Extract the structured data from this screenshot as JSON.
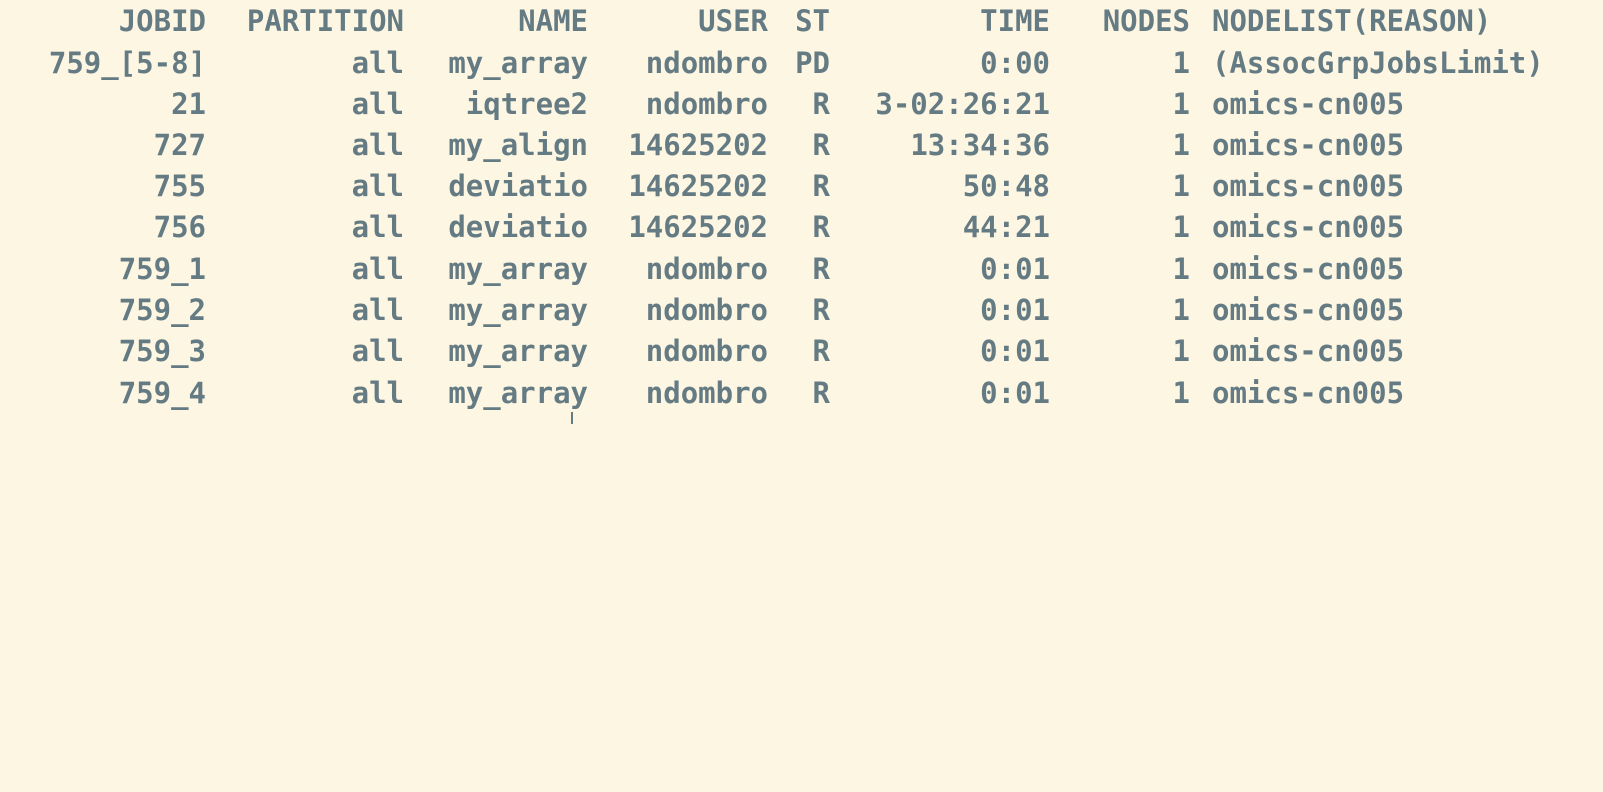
{
  "terminal": {
    "background_color": "#fdf6e3",
    "text_color": "#657b83",
    "columns": [
      "JOBID",
      "PARTITION",
      "NAME",
      "USER",
      "ST",
      "TIME",
      "NODES",
      "NODELIST(REASON)"
    ],
    "rows": [
      [
        "759_[5-8]",
        "all",
        "my_array",
        "ndombro",
        "PD",
        "0:00",
        "1",
        "(AssocGrpJobsLimit)"
      ],
      [
        "21",
        "all",
        "iqtree2",
        "ndombro",
        "R",
        "3-02:26:21",
        "1",
        "omics-cn005"
      ],
      [
        "727",
        "all",
        "my_align",
        "14625202",
        "R",
        "13:34:36",
        "1",
        "omics-cn005"
      ],
      [
        "755",
        "all",
        "deviatio",
        "14625202",
        "R",
        "50:48",
        "1",
        "omics-cn005"
      ],
      [
        "756",
        "all",
        "deviatio",
        "14625202",
        "R",
        "44:21",
        "1",
        "omics-cn005"
      ],
      [
        "759_1",
        "all",
        "my_array",
        "ndombro",
        "R",
        "0:01",
        "1",
        "omics-cn005"
      ],
      [
        "759_2",
        "all",
        "my_array",
        "ndombro",
        "R",
        "0:01",
        "1",
        "omics-cn005"
      ],
      [
        "759_3",
        "all",
        "my_array",
        "ndombro",
        "R",
        "0:01",
        "1",
        "omics-cn005"
      ],
      [
        "759_4",
        "all",
        "my_array",
        "ndombro",
        "R",
        "0:01",
        "1",
        "omics-cn005"
      ]
    ]
  }
}
